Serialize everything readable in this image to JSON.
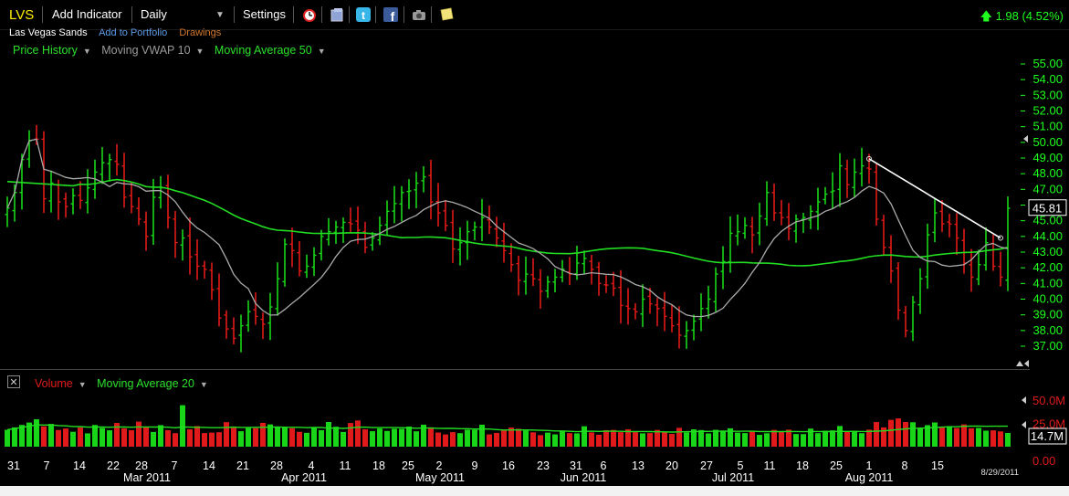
{
  "toolbar": {
    "ticker": "LVS",
    "add_indicator": "Add Indicator",
    "period": "Daily",
    "settings": "Settings",
    "change": "1.98 (4.52%)"
  },
  "subheader": {
    "company": "Las Vegas Sands",
    "add_portfolio": "Add to Portfolio",
    "drawings": "Drawings"
  },
  "legend": {
    "price_history": "Price History",
    "vwap": "Moving VWAP 10",
    "ma50": "Moving Average 50",
    "volume": "Volume",
    "ma20": "Moving Average 20"
  },
  "footer_date": "8/29/2011",
  "colors": {
    "up": "#19d619",
    "down": "#e01a1a",
    "ma": "#22dd22",
    "vwap": "#aaaaaa",
    "axis_text": "#1eff1e",
    "volume_axis_text": "#e01a1a"
  },
  "chart_data": [
    {
      "type": "line",
      "title": "LVS",
      "y_ticks": [
        37,
        38,
        39,
        40,
        41,
        42,
        43,
        44,
        45,
        46,
        47,
        48,
        49,
        50,
        51,
        52,
        53,
        54,
        55
      ],
      "y_tick_labels": [
        "37.00",
        "38.00",
        "39.00",
        "40.00",
        "41.00",
        "42.00",
        "43.00",
        "44.00",
        "45.00",
        "46.00",
        "47.00",
        "48.00",
        "49.00",
        "50.00",
        "51.00",
        "52.00",
        "53.00",
        "54.00",
        "55.00"
      ],
      "ylim": [
        36.3,
        55.6
      ],
      "last_price": 45.81,
      "last_price_label": "45.81",
      "x_ticks": [
        "31",
        "7",
        "14",
        "22",
        "28",
        "7",
        "14",
        "21",
        "28",
        "4",
        "11",
        "18",
        "25",
        "2",
        "9",
        "16",
        "23",
        "31",
        "6",
        "13",
        "20",
        "27",
        "5",
        "11",
        "18",
        "25",
        "1",
        "8",
        "15"
      ],
      "month_labels": [
        "Mar 2011",
        "Apr 2011",
        "May 2011",
        "Jun 2011",
        "Jul 2011",
        "Aug 2011"
      ],
      "series": [
        {
          "name": "Price History",
          "values": [
            45.8,
            46.8,
            48.9,
            50.1,
            50.2,
            46.4,
            47.4,
            46.2,
            45.9,
            46.6,
            46.3,
            47.1,
            48.1,
            48.7,
            48.9,
            48.6,
            46.5,
            45.9,
            45.1,
            44.0,
            46.5,
            47.1,
            45.2,
            43.6,
            43.9,
            42.7,
            42.1,
            41.9,
            40.6,
            38.8,
            38.1,
            37.5,
            38.3,
            39.2,
            38.9,
            38.4,
            39.5,
            41.3,
            43.5,
            43.1,
            41.8,
            42.1,
            42.8,
            44.0,
            44.3,
            44.6,
            44.9,
            44.8,
            44.4,
            43.3,
            43.9,
            44.7,
            45.6,
            46.1,
            46.8,
            46.9,
            47.4,
            47.8,
            46.2,
            45.5,
            44.7,
            43.2,
            43.6,
            44.3,
            44.6,
            45.2,
            44.6,
            43.9,
            43.1,
            42.2,
            41.2,
            41.6,
            41.3,
            40.5,
            41.1,
            41.4,
            41.9,
            41.6,
            42.3,
            42.6,
            41.9,
            41.0,
            40.9,
            40.7,
            39.6,
            39.4,
            39.2,
            40.0,
            39.7,
            39.4,
            38.9,
            38.3,
            37.7,
            38.0,
            38.6,
            39.4,
            40.0,
            41.6,
            42.4,
            44.2,
            44.3,
            44.7,
            44.1,
            45.3,
            46.8,
            45.5,
            45.2,
            44.5,
            45.1,
            45.2,
            45.6,
            46.2,
            46.7,
            46.9,
            48.5,
            47.3,
            48.1,
            48.5,
            48.3,
            45.1,
            43.3,
            41.8,
            39.3,
            38.0,
            39.8,
            41.3,
            44.1,
            45.5,
            44.8,
            44.8,
            43.9,
            42.3,
            41.4,
            42.2,
            43.6,
            42.1,
            41.4,
            45.8
          ]
        },
        {
          "name": "Moving VWAP 10"
        },
        {
          "name": "Moving Average 50"
        }
      ]
    },
    {
      "type": "bar",
      "title": "Volume",
      "y_ticks": [
        25,
        50
      ],
      "y_tick_labels": [
        "25.0M",
        "50.0M"
      ],
      "zero_label": "0.00",
      "last_volume_label": "14.7M",
      "series": [
        {
          "name": "Volume",
          "values": [
            18.1,
            20.7,
            23.3,
            25.9,
            29.4,
            21.8,
            24.4,
            17.9,
            19.5,
            16.0,
            20.5,
            14.3,
            23.3,
            20.0,
            17.6,
            25.5,
            19.7,
            17.7,
            26.9,
            21.2,
            15.8,
            23.1,
            17.7,
            14.5,
            44.5,
            18.6,
            22.1,
            14.6,
            15.1,
            15.5,
            26.3,
            20.3,
            16.6,
            20.0,
            19.9,
            25.6,
            23.9,
            20.6,
            21.4,
            19.8,
            15.9,
            14.9,
            21.1,
            17.7,
            26.5,
            21.4,
            15.8,
            25.4,
            28.1,
            18.6,
            16.6,
            19.5,
            16.9,
            19.3,
            19.2,
            21.6,
            16.5,
            23.6,
            20.7,
            15.2,
            13.1,
            15.6,
            14.5,
            18.2,
            18.1,
            23.6,
            13.2,
            14.8,
            17.5,
            20.5,
            19.2,
            17.4,
            15.4,
            12.4,
            15.1,
            13.2,
            16.4,
            14.5,
            14.3,
            21.9,
            15.3,
            12.8,
            17.7,
            18.0,
            15.6,
            18.7,
            15.6,
            14.3,
            14.6,
            18.0,
            15.8,
            13.7,
            20.2,
            15.3,
            18.6,
            17.8,
            14.2,
            18.1,
            16.4,
            19.7,
            15.1,
            14.6,
            16.3,
            12.7,
            14.4,
            18.0,
            15.6,
            18.3,
            13.6,
            13.5,
            19.4,
            14.5,
            17.1,
            17.5,
            22.2,
            15.9,
            16.2,
            14.5,
            18.3,
            26.4,
            20.7,
            28.8,
            30.3,
            26.5,
            26.2,
            20.5,
            23.1,
            26.0,
            21.4,
            22.1,
            20.0,
            23.9,
            19.7,
            20.1,
            17.2,
            17.5,
            16.4,
            14.7
          ]
        },
        {
          "name": "Moving Average 20"
        }
      ]
    }
  ]
}
